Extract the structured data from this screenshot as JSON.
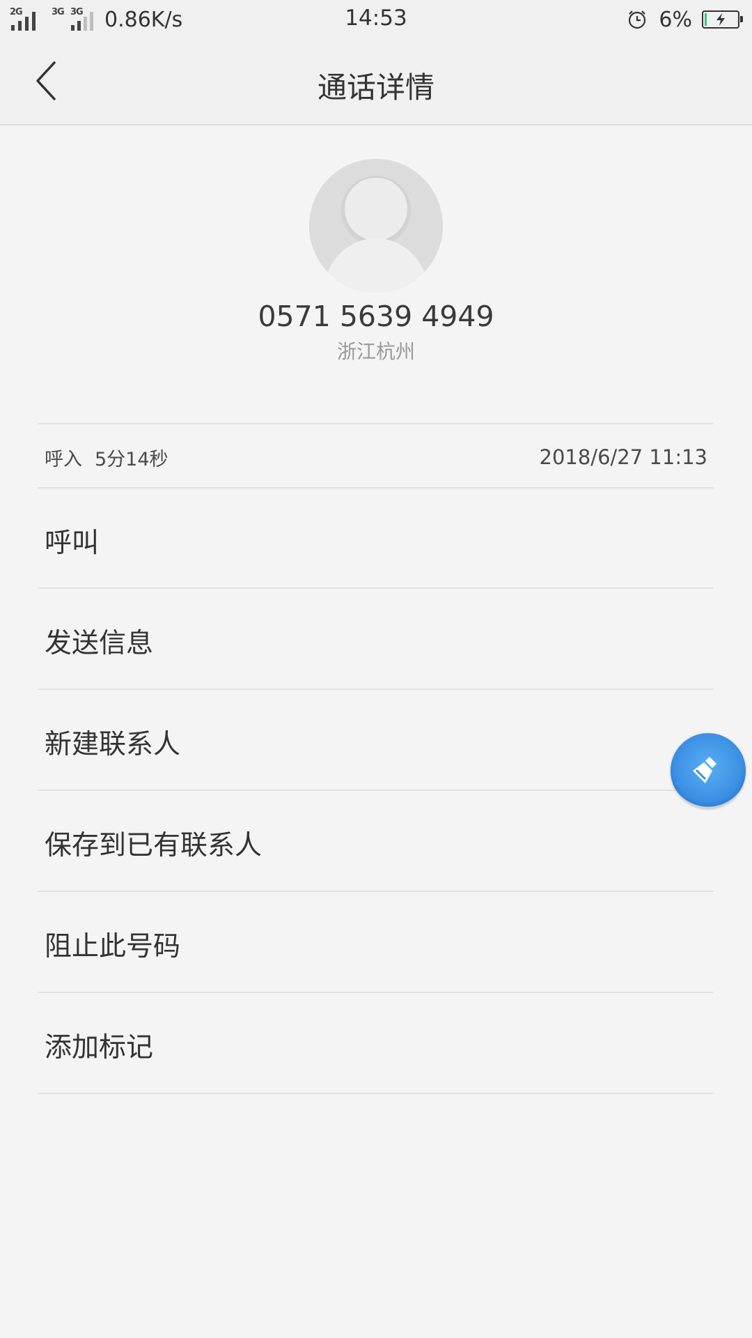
{
  "status_bar": {
    "sim1_network": "2G",
    "sim2_network": "3G",
    "sim2_network_b": "3G",
    "net_speed": "0.86K/s",
    "time": "14:53",
    "battery_percent": "6%",
    "battery_level": 0.06,
    "charging": true,
    "accent_charge_color": "#3cc47c"
  },
  "header": {
    "title": "通话详情",
    "back_icon": "back-arrow-icon"
  },
  "contact": {
    "phone_number": "0571 5639 4949",
    "location": "浙江杭州",
    "avatar_icon": "default-avatar-icon"
  },
  "call_log": {
    "type": "呼入",
    "duration": "5分14秒",
    "datetime": "2018/6/27 11:13"
  },
  "actions": [
    {
      "label": "呼叫"
    },
    {
      "label": "发送信息"
    },
    {
      "label": "新建联系人"
    },
    {
      "label": "保存到已有联系人"
    },
    {
      "label": "阻止此号码"
    },
    {
      "label": "添加标记"
    }
  ],
  "floating_button": {
    "icon": "broom-clean-icon",
    "color": "#3a8fe4"
  }
}
